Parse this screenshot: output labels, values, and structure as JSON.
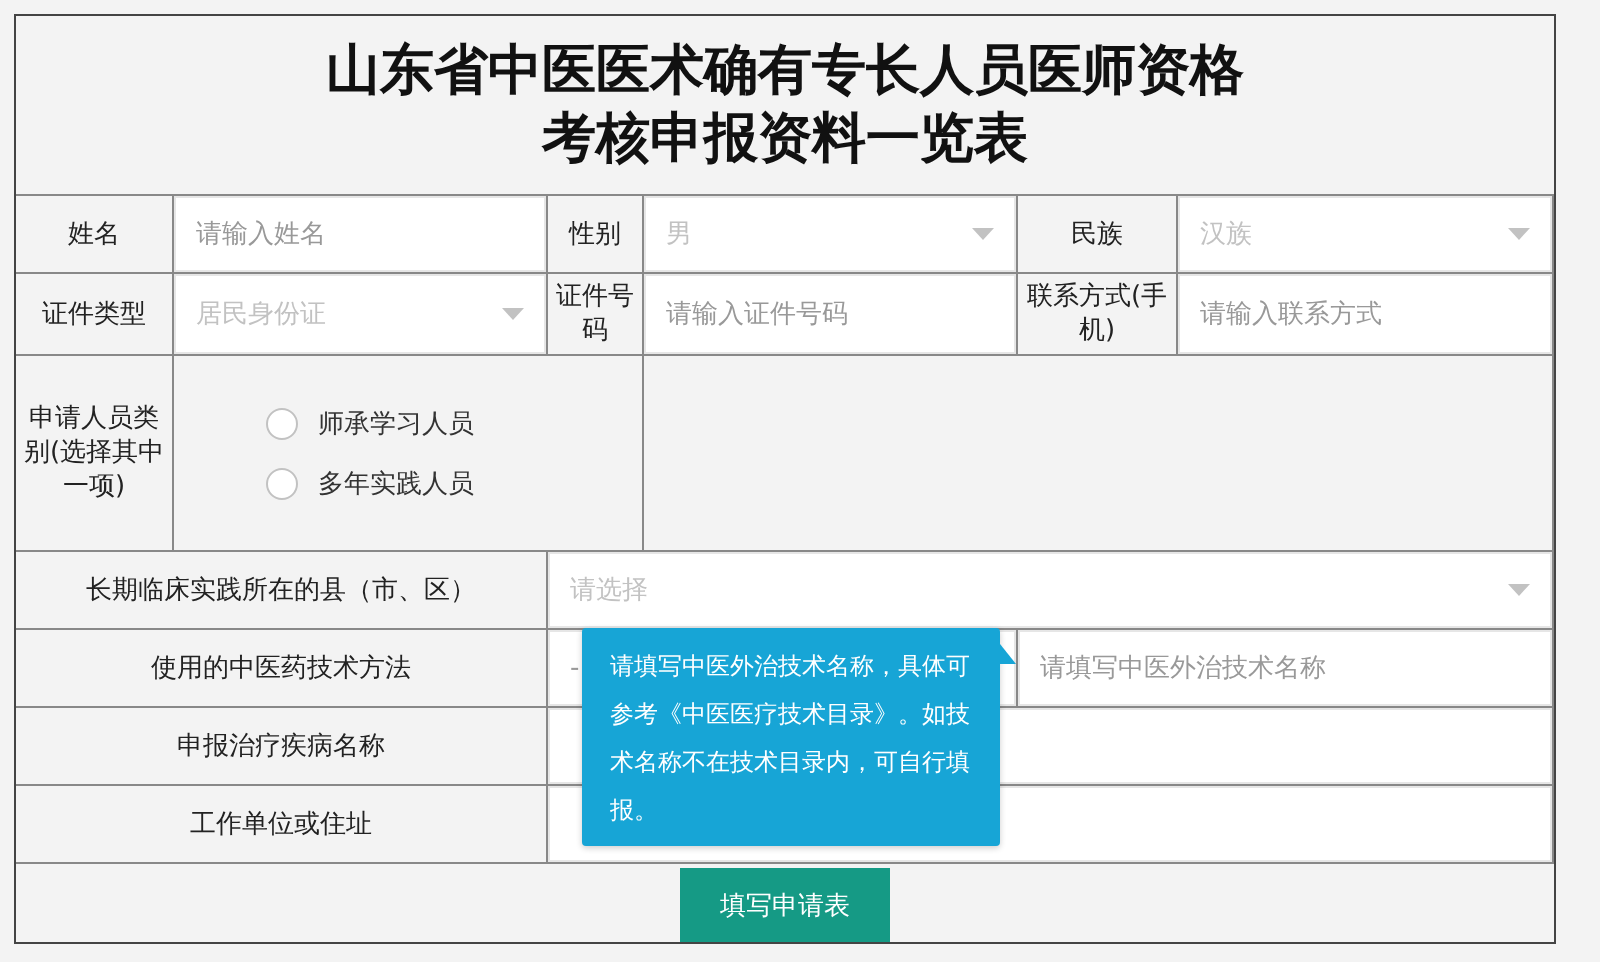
{
  "title": [
    "山东省中医医术确有专长人员医师资格",
    "考核申报资料一览表"
  ],
  "rows": [
    {
      "cells": [
        {
          "kind": "label",
          "text": "姓名"
        },
        {
          "kind": "input",
          "placeholder": "请输入姓名"
        },
        {
          "kind": "label",
          "text": "性别"
        },
        {
          "kind": "select",
          "placeholder": "男"
        },
        {
          "kind": "label",
          "text": "民族"
        },
        {
          "kind": "select",
          "placeholder": "汉族"
        }
      ]
    },
    {
      "cells": [
        {
          "kind": "label",
          "text": "证件类型"
        },
        {
          "kind": "select",
          "placeholder": "居民身份证"
        },
        {
          "kind": "label",
          "text": "证件号码"
        },
        {
          "kind": "input",
          "placeholder": "请输入证件号码"
        },
        {
          "kind": "label",
          "text": "联系方式(手机)"
        },
        {
          "kind": "input",
          "placeholder": "请输入联系方式"
        }
      ]
    },
    {
      "cells": [
        {
          "kind": "label",
          "text": "申请人员类别(选择其中一项)"
        },
        {
          "kind": "radios",
          "options": [
            {
              "label": "师承学习人员",
              "selected": false
            },
            {
              "label": "多年实践人员",
              "selected": false
            }
          ]
        },
        {
          "kind": "blank"
        }
      ]
    },
    {
      "cells": [
        {
          "kind": "label",
          "text": "长期临床实践所在的县（市、区）"
        },
        {
          "kind": "select",
          "placeholder": "请选择"
        }
      ]
    },
    {
      "cells": [
        {
          "kind": "label",
          "text": "使用的中医药技术方法"
        },
        {
          "kind": "text",
          "value": "-"
        },
        {
          "kind": "input",
          "placeholder": "请填写中医外治技术名称"
        }
      ]
    },
    {
      "cells": [
        {
          "kind": "label",
          "text": "申报治疗疾病名称"
        },
        {
          "kind": "input"
        }
      ]
    },
    {
      "cells": [
        {
          "kind": "label",
          "text": "工作单位或住址"
        },
        {
          "kind": "input"
        }
      ]
    },
    {
      "cells": [
        {
          "kind": "button",
          "text": "填写申请表"
        }
      ]
    }
  ],
  "tooltip": {
    "text": "请填写中医外治技术名称，具体可参考《中医医疗技术目录》。如技术名称不在技术目录内，可自行填报。"
  }
}
